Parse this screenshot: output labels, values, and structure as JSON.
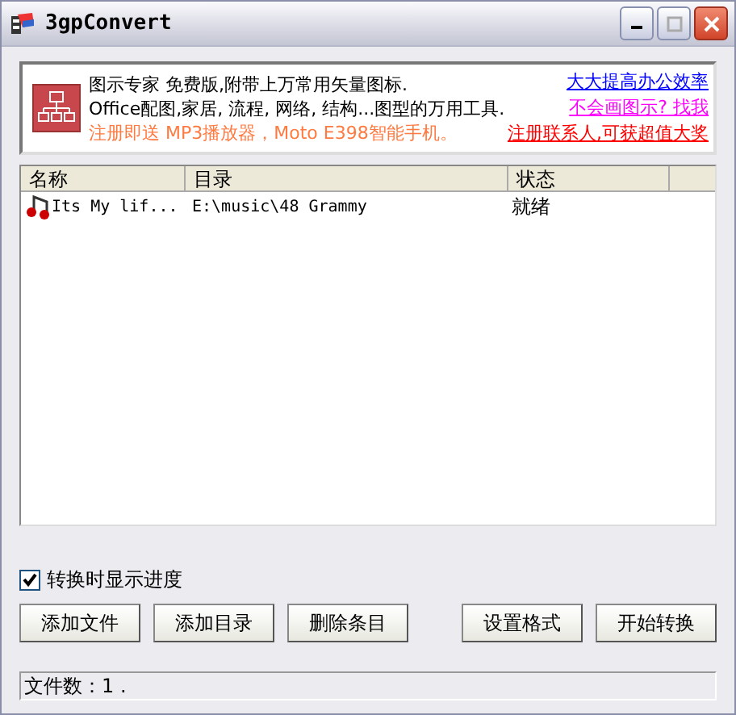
{
  "window": {
    "title": "3gpConvert"
  },
  "banner": {
    "lines": [
      "图示专家 免费版,附带上万常用矢量图标.",
      "Office配图,家居, 流程, 网络, 结构...图型的万用工具.",
      "注册即送 MP3播放器，Moto E398智能手机。"
    ],
    "links": [
      {
        "text": "大大提高办公效率",
        "color": "#0000ff"
      },
      {
        "text": "不会画图示? 找我",
        "color": "#ff00ff"
      },
      {
        "text": "注册联系人,可获超值大奖",
        "color": "#ff0000"
      }
    ]
  },
  "table": {
    "columns": [
      "名称",
      "目录",
      "状态"
    ],
    "rows": [
      {
        "name": "Its My lif...",
        "directory": "E:\\music\\48 Grammy",
        "status": "就绪"
      }
    ]
  },
  "show_progress": {
    "label": "转换时显示进度",
    "checked": true
  },
  "buttons_left": [
    "添加文件",
    "添加目录",
    "删除条目"
  ],
  "buttons_right": [
    "设置格式",
    "开始转换"
  ],
  "status_bar": "文件数：1 ."
}
